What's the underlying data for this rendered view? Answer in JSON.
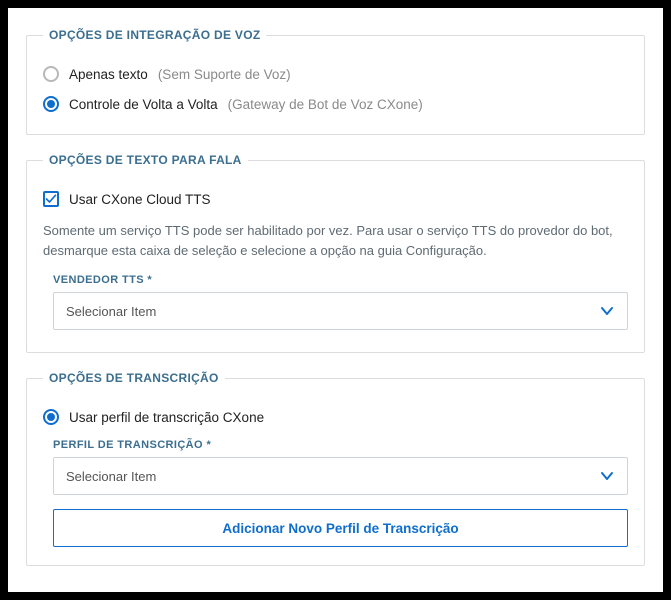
{
  "voiceIntegration": {
    "legend": "OPÇÕES DE INTEGRAÇÃO DE VOZ",
    "options": [
      {
        "label": "Apenas texto",
        "hint": "(Sem Suporte de Voz)",
        "selected": false
      },
      {
        "label": "Controle de Volta a Volta",
        "hint": "(Gateway de Bot de Voz CXone)",
        "selected": true
      }
    ]
  },
  "tts": {
    "legend": "OPÇÕES DE TEXTO PARA FALA",
    "checkboxLabel": "Usar CXone Cloud TTS",
    "checkboxChecked": true,
    "description": "Somente um serviço TTS pode ser habilitado por vez. Para usar o serviço TTS do provedor do bot, desmarque esta caixa de seleção e selecione a opção na guia Configuração.",
    "vendorLabel": "VENDEDOR TTS *",
    "vendorPlaceholder": "Selecionar Item"
  },
  "transcription": {
    "legend": "OPÇÕES DE TRANSCRIÇÃO",
    "radioLabel": "Usar perfil de transcrição CXone",
    "radioSelected": true,
    "profileLabel": "PERFIL DE TRANSCRIÇÃO *",
    "profilePlaceholder": "Selecionar Item",
    "addButton": "Adicionar Novo Perfil de Transcrição"
  }
}
